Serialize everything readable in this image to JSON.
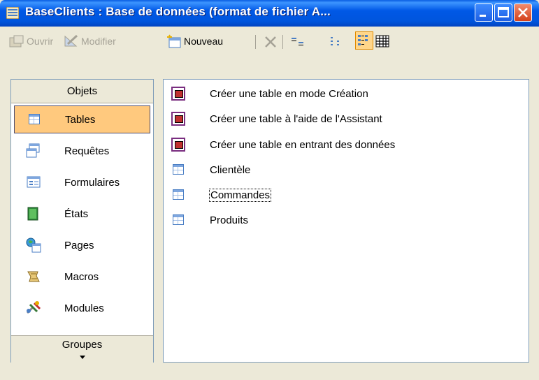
{
  "window": {
    "title": "BaseClients : Base de données (format de fichier A...",
    "accent": "#0055DD"
  },
  "toolbar": {
    "open_label": "Ouvrir",
    "modify_label": "Modifier",
    "new_label": "Nouveau"
  },
  "sidebar": {
    "header": "Objets",
    "items": [
      {
        "label": "Tables",
        "icon": "table-icon",
        "selected": true
      },
      {
        "label": "Requêtes",
        "icon": "query-icon"
      },
      {
        "label": "Formulaires",
        "icon": "form-icon"
      },
      {
        "label": "États",
        "icon": "report-icon"
      },
      {
        "label": "Pages",
        "icon": "page-icon"
      },
      {
        "label": "Macros",
        "icon": "macro-icon"
      },
      {
        "label": "Modules",
        "icon": "module-icon"
      }
    ],
    "groups_label": "Groupes",
    "selected_color": "#FFC97E"
  },
  "content": {
    "items": [
      {
        "label": "Créer une table en mode Création",
        "icon": "wizard-icon"
      },
      {
        "label": "Créer une table à l'aide de l'Assistant",
        "icon": "wizard-icon"
      },
      {
        "label": "Créer une table en entrant des données",
        "icon": "wizard-icon"
      },
      {
        "label": "Clientèle",
        "icon": "table-icon"
      },
      {
        "label": "Commandes",
        "icon": "table-icon",
        "focused": true
      },
      {
        "label": "Produits",
        "icon": "table-icon"
      }
    ]
  }
}
